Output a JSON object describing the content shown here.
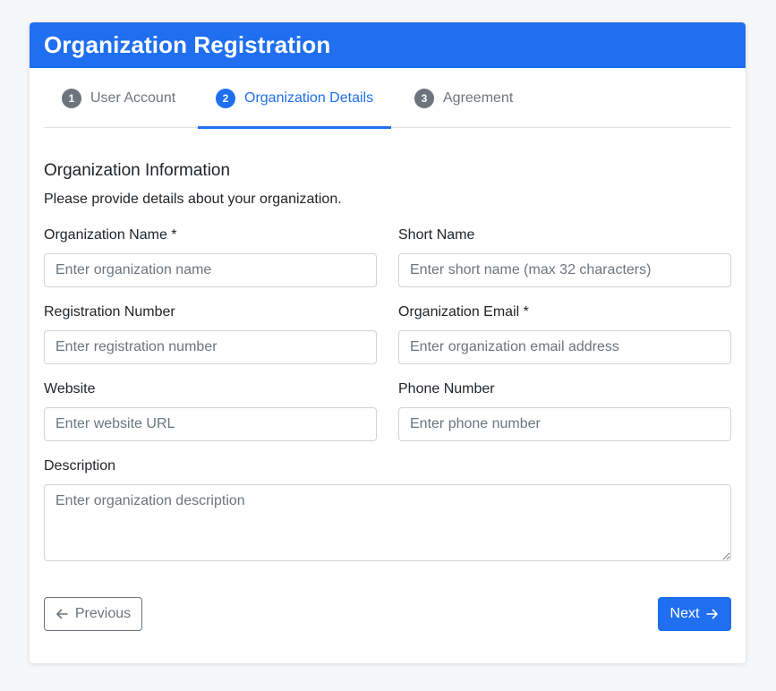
{
  "header": {
    "title": "Organization Registration",
    "color": "#1f6ff0"
  },
  "steps": [
    {
      "number": "1",
      "label": "User Account",
      "active": false
    },
    {
      "number": "2",
      "label": "Organization Details",
      "active": true
    },
    {
      "number": "3",
      "label": "Agreement",
      "active": false
    }
  ],
  "section": {
    "title": "Organization Information",
    "description": "Please provide details about your organization."
  },
  "fields": {
    "org_name": {
      "label": "Organization Name *",
      "value": "",
      "placeholder": "Enter organization name"
    },
    "short_name": {
      "label": "Short Name",
      "value": "",
      "placeholder": "Enter short name (max 32 characters)"
    },
    "reg_number": {
      "label": "Registration Number",
      "value": "",
      "placeholder": "Enter registration number"
    },
    "org_email": {
      "label": "Organization Email *",
      "value": "",
      "placeholder": "Enter organization email address"
    },
    "website": {
      "label": "Website",
      "value": "",
      "placeholder": "Enter website URL"
    },
    "phone": {
      "label": "Phone Number",
      "value": "",
      "placeholder": "Enter phone number"
    },
    "description": {
      "label": "Description",
      "value": "",
      "placeholder": "Enter organization description"
    }
  },
  "buttons": {
    "previous": {
      "label": "Previous",
      "icon": "arrow-left-icon"
    },
    "next": {
      "label": "Next",
      "icon": "arrow-right-icon"
    }
  }
}
